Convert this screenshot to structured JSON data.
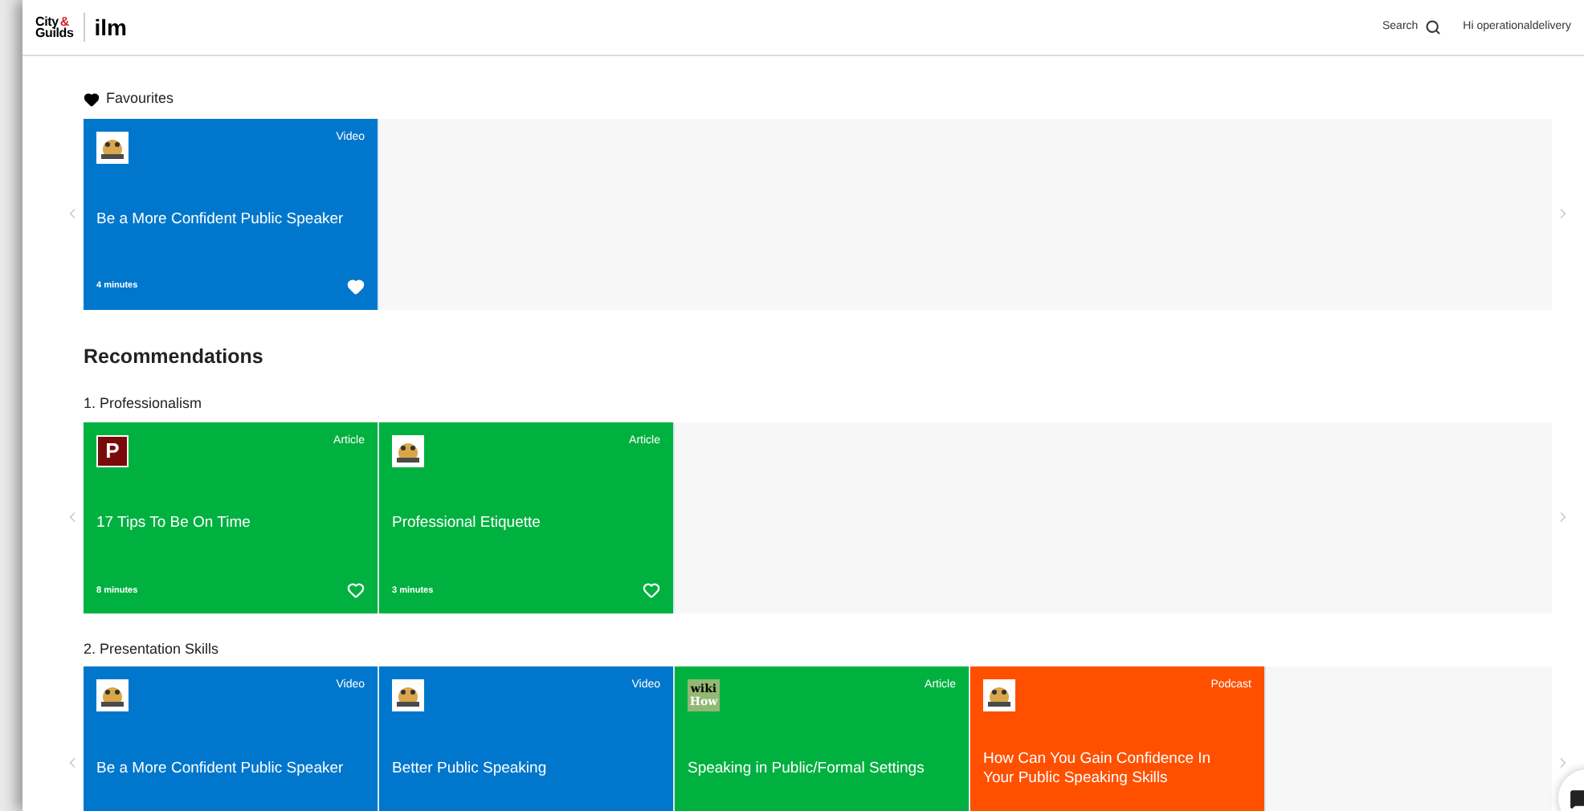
{
  "header": {
    "logo": {
      "top": "City",
      "amp": "&",
      "bottom": "Guilds",
      "brand": "ilm"
    },
    "search_label": "Search",
    "greeting": "Hi operationaldelivery"
  },
  "favourites": {
    "title": "Favourites",
    "cards": [
      {
        "type": "Video",
        "color": "#0077cc",
        "title": "Be a More Confident Public Speaker",
        "duration": "4 minutes",
        "favourite": true
      }
    ]
  },
  "recommendations": {
    "title": "Recommendations",
    "groups": [
      {
        "title": "1. Professionalism",
        "cards": [
          {
            "type": "Article",
            "color": "#00b140",
            "thumb": {
              "kind": "letter",
              "text": "P"
            },
            "title": "17 Tips To Be On Time",
            "duration": "8 minutes",
            "favourite": false
          },
          {
            "type": "Article",
            "color": "#00b140",
            "title": "Professional Etiquette",
            "duration": "3 minutes",
            "favourite": false
          }
        ]
      },
      {
        "title": "2. Presentation Skills",
        "cards": [
          {
            "type": "Video",
            "color": "#0077cc",
            "title": "Be a More Confident Public Speaker"
          },
          {
            "type": "Video",
            "color": "#0077cc",
            "title": "Better Public Speaking"
          },
          {
            "type": "Article",
            "color": "#00b140",
            "thumb": {
              "kind": "logo",
              "lines": [
                "wiki",
                "How"
              ]
            },
            "title": "Speaking in Public/Formal Settings"
          },
          {
            "type": "Podcast",
            "color": "#ff5000",
            "title": "How Can You Gain Confidence In Your Public Speaking Skills"
          }
        ]
      }
    ]
  }
}
